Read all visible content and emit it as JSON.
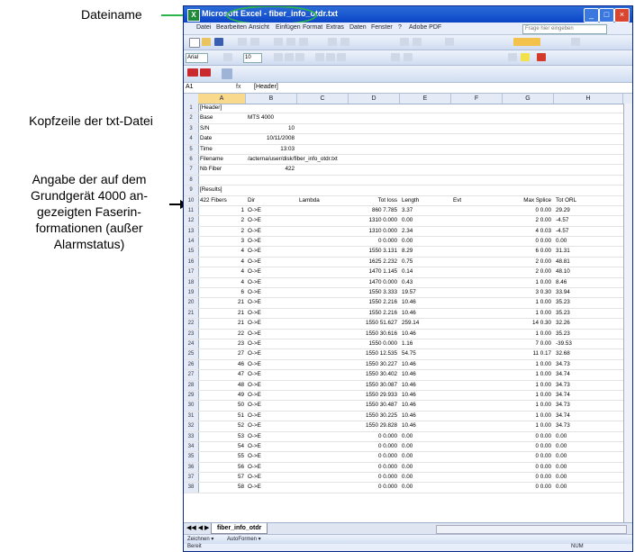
{
  "annotations": {
    "dateiname": "Dateiname",
    "kopfzeile": "Kopfzeile der txt-Datei",
    "angabe": "Angabe der auf dem Grundgerät 4000 angezeigten Faserinformationen (außer Alarmstatus)",
    "angabe_lines": [
      "Angabe der auf dem",
      "Grundgerät 4000 an-",
      "gezeigten Faserin-",
      "formationen (außer",
      "Alarmstatus)"
    ]
  },
  "window": {
    "app_name": "Microsoft Excel",
    "file_name": "fiber_info_otdr.txt",
    "title_separator": " - ",
    "buttons": {
      "minimize": "_",
      "maximize": "□",
      "close": "×"
    }
  },
  "menu": [
    "Datei",
    "Bearbeiten",
    "Ansicht",
    "Einfügen",
    "Format",
    "Extras",
    "Daten",
    "Fenster",
    "?",
    "Adobe PDF"
  ],
  "ask_box_placeholder": "Frage hier eingeben",
  "name_box": "A1",
  "font_name": "Arial",
  "font_size": "10",
  "formula": {
    "fx": "fx",
    "value": "[Header]"
  },
  "columns": [
    "A",
    "B",
    "C",
    "D",
    "E",
    "F",
    "G",
    "H"
  ],
  "rows": [
    {
      "n": "1",
      "a": "[Header]",
      "b": "",
      "c": "",
      "d": "",
      "e": "",
      "f": "",
      "g": "",
      "h": ""
    },
    {
      "n": "2",
      "a": "Base",
      "b": "MTS 4000",
      "c": "",
      "d": "",
      "e": "",
      "f": "",
      "g": "",
      "h": ""
    },
    {
      "n": "3",
      "a": "S/N",
      "b": "10",
      "c": "",
      "d": "",
      "e": "",
      "f": "",
      "g": "",
      "h": ""
    },
    {
      "n": "4",
      "a": "Date",
      "b": "10/11/2008",
      "c": "",
      "d": "",
      "e": "",
      "f": "",
      "g": "",
      "h": ""
    },
    {
      "n": "5",
      "a": "Time",
      "b": "13:03",
      "c": "",
      "d": "",
      "e": "",
      "f": "",
      "g": "",
      "h": ""
    },
    {
      "n": "6",
      "a": "Filename",
      "b": "/acterna/user/disk/fiber_info_otdr.txt",
      "c": "",
      "d": "",
      "e": "",
      "f": "",
      "g": "",
      "h": ""
    },
    {
      "n": "7",
      "a": "Nb Fiber",
      "b": "422",
      "c": "",
      "d": "",
      "e": "",
      "f": "",
      "g": "",
      "h": ""
    },
    {
      "n": "8",
      "a": "",
      "b": "",
      "c": "",
      "d": "",
      "e": "",
      "f": "",
      "g": "",
      "h": ""
    },
    {
      "n": "9",
      "a": "[Results]",
      "b": "",
      "c": "",
      "d": "",
      "e": "",
      "f": "",
      "g": "",
      "h": ""
    },
    {
      "n": "10",
      "a": "422 Fibers",
      "b": "Dir",
      "c": "Lambda",
      "d": "Tot loss",
      "e": "Length",
      "f": "Evt",
      "g": "Max Splice",
      "h": "Tot ORL"
    },
    {
      "n": "11",
      "a": "1",
      "b": "O->E",
      "c": "",
      "d": "860 7.785",
      "e": "3.37",
      "f": "",
      "g": "0 0.00",
      "h": "29.29"
    },
    {
      "n": "12",
      "a": "2",
      "b": "O->E",
      "c": "",
      "d": "1310 0.000",
      "e": "0.00",
      "f": "",
      "g": "2 0.00",
      "h": "-4.57"
    },
    {
      "n": "13",
      "a": "2",
      "b": "O->E",
      "c": "",
      "d": "1310 0.000",
      "e": "2.34",
      "f": "",
      "g": "4 0.03",
      "h": "-4.57"
    },
    {
      "n": "14",
      "a": "3",
      "b": "O->E",
      "c": "",
      "d": "0 0.000",
      "e": "0.00",
      "f": "",
      "g": "0 0.00",
      "h": "0.00"
    },
    {
      "n": "15",
      "a": "4",
      "b": "O->E",
      "c": "",
      "d": "1550 3.131",
      "e": "8.29",
      "f": "",
      "g": "6 0.00",
      "h": "31.31"
    },
    {
      "n": "16",
      "a": "4",
      "b": "O->E",
      "c": "",
      "d": "1625 2.232",
      "e": "0.75",
      "f": "",
      "g": "2 0.00",
      "h": "48.81"
    },
    {
      "n": "17",
      "a": "4",
      "b": "O->E",
      "c": "",
      "d": "1470 1.145",
      "e": "0.14",
      "f": "",
      "g": "2 0.00",
      "h": "48.10"
    },
    {
      "n": "18",
      "a": "4",
      "b": "O->E",
      "c": "",
      "d": "1470 0.000",
      "e": "0.43",
      "f": "",
      "g": "1 0.00",
      "h": "8.46"
    },
    {
      "n": "19",
      "a": "6",
      "b": "O->E",
      "c": "",
      "d": "1550 3.333",
      "e": "19.57",
      "f": "",
      "g": "3 0.30",
      "h": "33.94"
    },
    {
      "n": "20",
      "a": "21",
      "b": "O->E",
      "c": "",
      "d": "1550 2.216",
      "e": "10.46",
      "f": "",
      "g": "1 0.00",
      "h": "35.23"
    },
    {
      "n": "21",
      "a": "21",
      "b": "O->E",
      "c": "",
      "d": "1550 2.216",
      "e": "10.46",
      "f": "",
      "g": "1 0.00",
      "h": "35.23"
    },
    {
      "n": "22",
      "a": "21",
      "b": "O->E",
      "c": "",
      "d": "1550 51.627",
      "e": "259.14",
      "f": "",
      "g": "14 0.30",
      "h": "32.26"
    },
    {
      "n": "23",
      "a": "22",
      "b": "O->E",
      "c": "",
      "d": "1550 30.616",
      "e": "10.46",
      "f": "",
      "g": "1 0.00",
      "h": "35.23"
    },
    {
      "n": "24",
      "a": "23",
      "b": "O->E",
      "c": "",
      "d": "1550 0.000",
      "e": "1.16",
      "f": "",
      "g": "7 0.00",
      "h": "-39.53"
    },
    {
      "n": "25",
      "a": "27",
      "b": "O->E",
      "c": "",
      "d": "1550 12.535",
      "e": "54.75",
      "f": "",
      "g": "11 0.17",
      "h": "32.68"
    },
    {
      "n": "26",
      "a": "46",
      "b": "O->E",
      "c": "",
      "d": "1550 30.227",
      "e": "10.46",
      "f": "",
      "g": "1 0.00",
      "h": "34.73"
    },
    {
      "n": "27",
      "a": "47",
      "b": "O->E",
      "c": "",
      "d": "1550 30.402",
      "e": "10.46",
      "f": "",
      "g": "1 0.00",
      "h": "34.74"
    },
    {
      "n": "28",
      "a": "48",
      "b": "O->E",
      "c": "",
      "d": "1550 30.087",
      "e": "10.46",
      "f": "",
      "g": "1 0.00",
      "h": "34.73"
    },
    {
      "n": "29",
      "a": "49",
      "b": "O->E",
      "c": "",
      "d": "1550 29.933",
      "e": "10.46",
      "f": "",
      "g": "1 0.00",
      "h": "34.74"
    },
    {
      "n": "30",
      "a": "50",
      "b": "O->E",
      "c": "",
      "d": "1550 30.487",
      "e": "10.46",
      "f": "",
      "g": "1 0.00",
      "h": "34.73"
    },
    {
      "n": "31",
      "a": "51",
      "b": "O->E",
      "c": "",
      "d": "1550 30.225",
      "e": "10.46",
      "f": "",
      "g": "1 0.00",
      "h": "34.74"
    },
    {
      "n": "32",
      "a": "52",
      "b": "O->E",
      "c": "",
      "d": "1550 29.828",
      "e": "10.46",
      "f": "",
      "g": "1 0.00",
      "h": "34.73"
    },
    {
      "n": "33",
      "a": "53",
      "b": "O->E",
      "c": "",
      "d": "0 0.000",
      "e": "0.00",
      "f": "",
      "g": "0 0.00",
      "h": "0.00"
    },
    {
      "n": "34",
      "a": "54",
      "b": "O->E",
      "c": "",
      "d": "0 0.000",
      "e": "0.00",
      "f": "",
      "g": "0 0.00",
      "h": "0.00"
    },
    {
      "n": "35",
      "a": "55",
      "b": "O->E",
      "c": "",
      "d": "0 0.000",
      "e": "0.00",
      "f": "",
      "g": "0 0.00",
      "h": "0.00"
    },
    {
      "n": "36",
      "a": "56",
      "b": "O->E",
      "c": "",
      "d": "0 0.000",
      "e": "0.00",
      "f": "",
      "g": "0 0.00",
      "h": "0.00"
    },
    {
      "n": "37",
      "a": "57",
      "b": "O->E",
      "c": "",
      "d": "0 0.000",
      "e": "0.00",
      "f": "",
      "g": "0 0.00",
      "h": "0.00"
    },
    {
      "n": "38",
      "a": "58",
      "b": "O->E",
      "c": "",
      "d": "0 0.000",
      "e": "0.00",
      "f": "",
      "g": "0 0.00",
      "h": "0.00"
    }
  ],
  "sheet_tab": "fiber_info_otdr",
  "drawbar": {
    "zeichnen": "Zeichnen ▾",
    "autoformen": "AutoFormen ▾"
  },
  "status": {
    "ready": "Bereit",
    "num": "NUM"
  },
  "colors": {
    "annotation_green": "#2bb54a",
    "titlebar": "#0b45c6"
  }
}
